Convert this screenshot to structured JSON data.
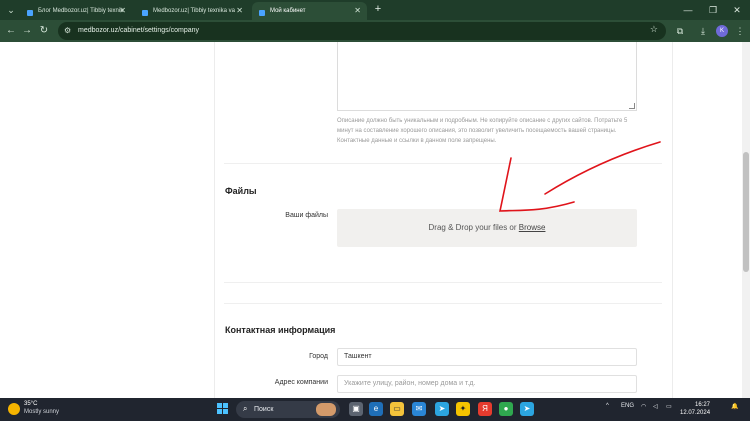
{
  "browser": {
    "tabs": [
      {
        "label": "Блог Medbozor.uz| Tibbiy texnik",
        "active": false
      },
      {
        "label": "Medbozor.uz| Tibbiy texnika va",
        "active": false
      },
      {
        "label": "Мой кабинет",
        "active": true
      }
    ],
    "url": "medbozor.uz/cabinet/settings/company",
    "profile_initial": "K"
  },
  "page": {
    "description_hint": "Описание должно быть уникальным и подробным. Не копируйте описание с других сайтов. Потратьте 5 минут на составление хорошего описания, это позволит увеличить посещаемость вашей страницы. Контактные данные и ссылки в данном поле запрещены.",
    "files_section": {
      "title": "Файлы",
      "label": "Ваши файлы",
      "dropzone_text": "Drag & Drop your files or",
      "browse_link": "Browse"
    },
    "contact_section": {
      "title": "Контактная информация",
      "city_label": "Город",
      "city_value": "Ташкент",
      "address_label": "Адрес компании",
      "address_placeholder": "Укажите улицу, район, номер дома и т.д."
    }
  },
  "taskbar": {
    "weather_temp": "35°C",
    "weather_condition": "Mostly sunny",
    "search_placeholder": "Поиск",
    "language": "ENG",
    "time": "16:27",
    "date": "12.07.2024"
  },
  "colors": {
    "annotation": "#e0141b",
    "chrome_dark": "#1f3d2a",
    "chrome_toolbar": "#2c4e37"
  }
}
